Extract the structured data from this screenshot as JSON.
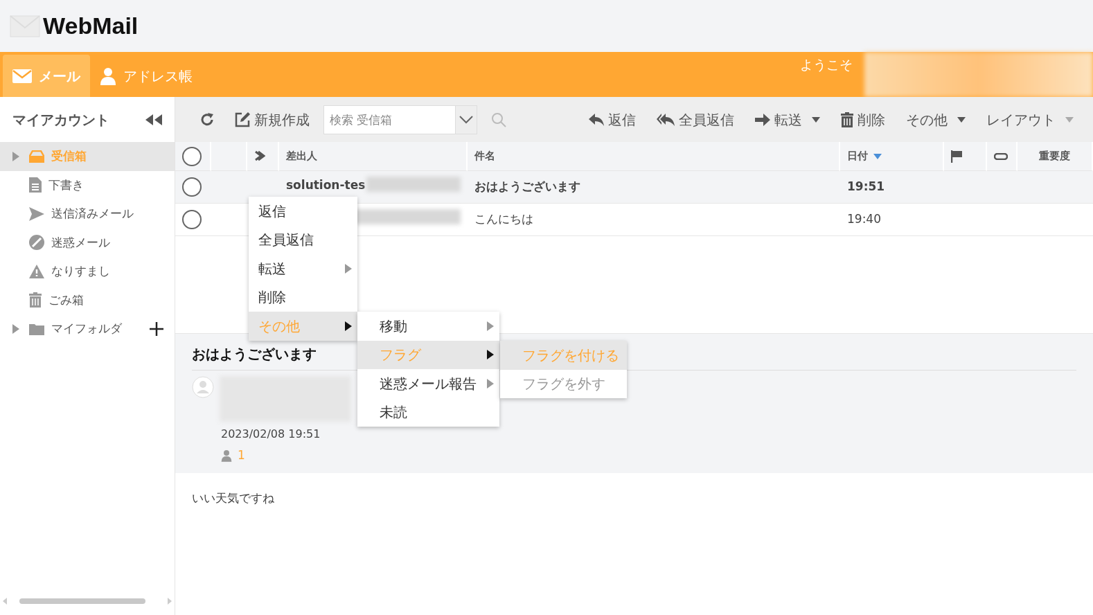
{
  "app": {
    "logo": "WebMail"
  },
  "nav": {
    "tabs": [
      {
        "label": "メール",
        "selected": true
      },
      {
        "label": "アドレス帳",
        "selected": false
      }
    ],
    "welcome": "ようこそ"
  },
  "sidebar": {
    "title": "マイアカウント",
    "folders": [
      {
        "label": "受信箱",
        "expandable": true,
        "selected": true
      },
      {
        "label": "下書き",
        "expandable": false,
        "selected": false
      },
      {
        "label": "送信済みメール",
        "expandable": false,
        "selected": false
      },
      {
        "label": "迷惑メール",
        "expandable": false,
        "selected": false
      },
      {
        "label": "なりすまし",
        "expandable": false,
        "selected": false
      },
      {
        "label": "ごみ箱",
        "expandable": false,
        "selected": false
      },
      {
        "label": "マイフォルダ",
        "expandable": true,
        "selected": false
      }
    ]
  },
  "toolbar": {
    "search_placeholder": "検索 受信箱",
    "buttons": [
      {
        "label": "新規作成",
        "dropdown": false
      },
      {
        "label": "返信",
        "dropdown": false
      },
      {
        "label": "全員返信",
        "dropdown": false
      },
      {
        "label": "転送",
        "dropdown": true
      },
      {
        "label": "削除",
        "dropdown": false
      },
      {
        "label": "その他",
        "dropdown": true
      },
      {
        "label": "レイアウト",
        "dropdown": true
      }
    ]
  },
  "table": {
    "all_checked": false,
    "columns": [
      {
        "label": "差出人",
        "sorted": false
      },
      {
        "label": "件名",
        "sorted": false
      },
      {
        "label": "日付",
        "sorted": true
      },
      {
        "label": "重要度",
        "sorted": false
      }
    ],
    "rows": [
      {
        "sender": "solution-tes",
        "subject": "おはようございます",
        "date": "19:51",
        "unread": true,
        "checked": false
      },
      {
        "subject": "こんにちは",
        "date": "19:40",
        "unread": false,
        "checked": false
      }
    ]
  },
  "context_menus": [
    {
      "items": [
        {
          "label": "返信",
          "submenu": false,
          "highlighted": false,
          "disabled": false
        },
        {
          "label": "全員返信",
          "submenu": false,
          "highlighted": false,
          "disabled": false
        },
        {
          "label": "転送",
          "submenu": true,
          "highlighted": false,
          "disabled": false
        },
        {
          "label": "削除",
          "submenu": false,
          "highlighted": false,
          "disabled": false
        },
        {
          "label": "その他",
          "submenu": true,
          "highlighted": true,
          "disabled": false
        }
      ]
    },
    {
      "items": [
        {
          "label": "移動",
          "submenu": true,
          "highlighted": false,
          "disabled": false
        },
        {
          "label": "フラグ",
          "submenu": true,
          "highlighted": true,
          "disabled": false
        },
        {
          "label": "迷惑メール報告",
          "submenu": true,
          "highlighted": false,
          "disabled": false
        },
        {
          "label": "未読",
          "submenu": false,
          "highlighted": false,
          "disabled": false
        }
      ]
    },
    {
      "items": [
        {
          "label": "フラグを付ける",
          "submenu": false,
          "highlighted": true,
          "disabled": false
        },
        {
          "label": "フラグを外す",
          "submenu": false,
          "highlighted": false,
          "disabled": true
        }
      ]
    }
  ],
  "preview": {
    "subject": "おはようございます",
    "date": "2023/02/08 19:51",
    "recipients": "1",
    "body": "いい天気ですね"
  }
}
